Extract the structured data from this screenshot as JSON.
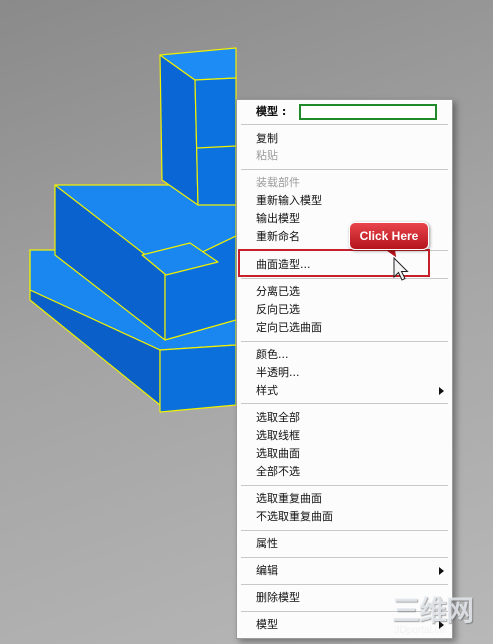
{
  "menu": {
    "header_label": "模型 :",
    "header_value": "",
    "items": [
      {
        "label": "复制"
      },
      {
        "label": "粘贴"
      },
      {
        "label": "装载部件"
      },
      {
        "label": "重新输入模型"
      },
      {
        "label": "输出模型"
      },
      {
        "label": "重新命名"
      },
      {
        "label": "曲面造型..."
      },
      {
        "label": "分离已选"
      },
      {
        "label": "反向已选"
      },
      {
        "label": "定向已选曲面"
      },
      {
        "label": "颜色..."
      },
      {
        "label": "半透明..."
      },
      {
        "label": "样式"
      },
      {
        "label": "选取全部"
      },
      {
        "label": "选取线框"
      },
      {
        "label": "选取曲面"
      },
      {
        "label": "全部不选"
      },
      {
        "label": "选取重复曲面"
      },
      {
        "label": "不选取重复曲面"
      },
      {
        "label": "属性"
      },
      {
        "label": "编辑"
      },
      {
        "label": "删除模型"
      },
      {
        "label": "模型"
      }
    ]
  },
  "callout": {
    "text": "Click Here"
  },
  "watermark": {
    "text": "三维网",
    "sub": "3Dportal.cn"
  },
  "colors": {
    "model_face": "#0a6fe0",
    "model_edge": "#f0f000",
    "callout": "#d0282f",
    "highlight": "#c8202a",
    "field_border": "#1f8a2a"
  }
}
